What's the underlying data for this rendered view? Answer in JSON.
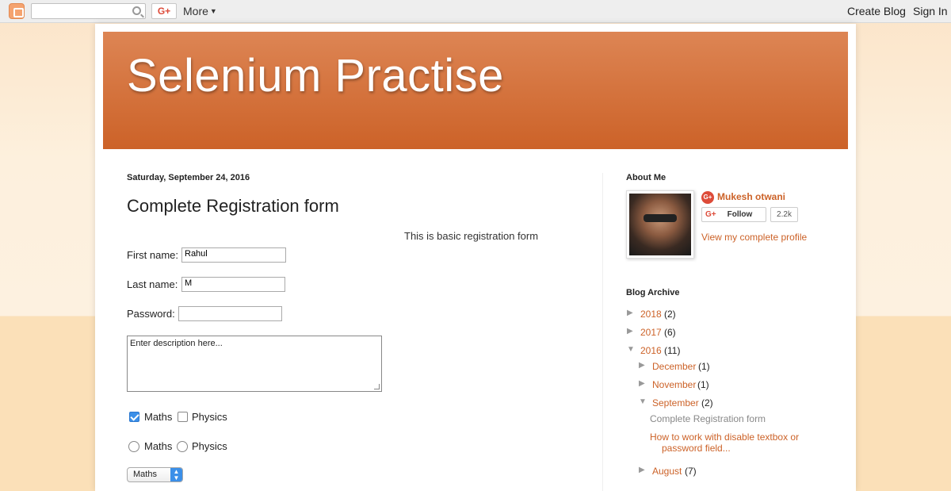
{
  "navbar": {
    "more_label": "More",
    "create_blog": "Create Blog",
    "sign_in": "Sign In",
    "gplus": "G+"
  },
  "header": {
    "title": "Selenium Practise"
  },
  "post": {
    "date": "Saturday, September 24, 2016",
    "title": "Complete Registration form",
    "description": "This is basic registration form",
    "first_name_label": "First name:",
    "first_name_value": "Rahul",
    "last_name_label": "Last name:",
    "last_name_value": "M",
    "password_label": "Password:",
    "textarea_value": "Enter description here...",
    "checkboxes": [
      {
        "label": "Maths",
        "checked": true
      },
      {
        "label": "Physics",
        "checked": false
      }
    ],
    "radios": [
      {
        "label": "Maths",
        "checked": false
      },
      {
        "label": "Physics",
        "checked": false
      }
    ],
    "select_value": "Maths"
  },
  "sidebar": {
    "about_heading": "About Me",
    "profile_name": "Mukesh otwani",
    "follow_label": "Follow",
    "follow_count": "2.2k",
    "view_profile": "View my complete profile",
    "archive_heading": "Blog Archive",
    "archive": {
      "y2018": {
        "label": "2018",
        "count": "(2)"
      },
      "y2017": {
        "label": "2017",
        "count": "(6)"
      },
      "y2016": {
        "label": "2016",
        "count": "(11)"
      },
      "december": {
        "label": "December",
        "count": "(1)"
      },
      "november": {
        "label": "November",
        "count": "(1)"
      },
      "september": {
        "label": "September",
        "count": "(2)"
      },
      "post1": "Complete Registration form",
      "post2_line1": "How to work with disable textbox or",
      "post2_line2": "password field...",
      "august": {
        "label": "August",
        "count": "(7)"
      }
    }
  },
  "colors": {
    "accent": "#cc6228",
    "banner_top": "#dd8554",
    "banner_bottom": "#cc6228"
  }
}
